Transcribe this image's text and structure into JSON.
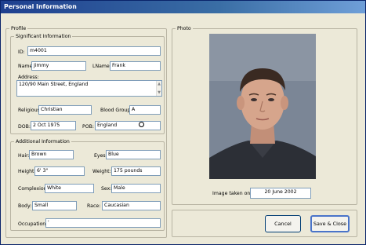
{
  "window": {
    "title": "Personal Information"
  },
  "profile": {
    "legend": "Profile",
    "significant": {
      "legend": "Significant Information",
      "id_label": "ID:",
      "id_value": "m4001",
      "name_label": "Name:",
      "name_value": "Jimmy",
      "lname_label": "LName:",
      "lname_value": "Frank",
      "address_label": "Address:",
      "address_value": "120/90 Main Street, England",
      "religious_label": "Religious:",
      "religious_value": "Christian",
      "blood_label": "Blood Group:",
      "blood_value": "A",
      "dob_label": "DOB:",
      "dob_value": "2 Oct 1975",
      "pob_label": "POB:",
      "pob_value": "England"
    },
    "additional": {
      "legend": "Additional Information",
      "hair_label": "Hair:",
      "hair_value": "Brown",
      "eyes_label": "Eyes:",
      "eyes_value": "Blue",
      "height_label": "Height:",
      "height_value": "6' 3\"",
      "weight_label": "Weight:",
      "weight_value": "175 pounds",
      "complexion_label": "Complexion:",
      "complexion_value": "White",
      "sex_label": "Sex:",
      "sex_value": "Male",
      "body_label": "Body:",
      "body_value": "Small",
      "race_label": "Race:",
      "race_value": "Caucasian",
      "occupations_label": "Occupations:",
      "occupations_value": "'"
    }
  },
  "photo": {
    "legend": "Photo",
    "taken_label": "Image taken on:",
    "taken_value": "20 June 2002"
  },
  "buttons": {
    "cancel": "Cancel",
    "save_close": "Save & Close"
  },
  "colors": {
    "titlebar": "#1e3f8f",
    "window_bg": "#ece9d8",
    "field_border": "#7f9db9"
  }
}
